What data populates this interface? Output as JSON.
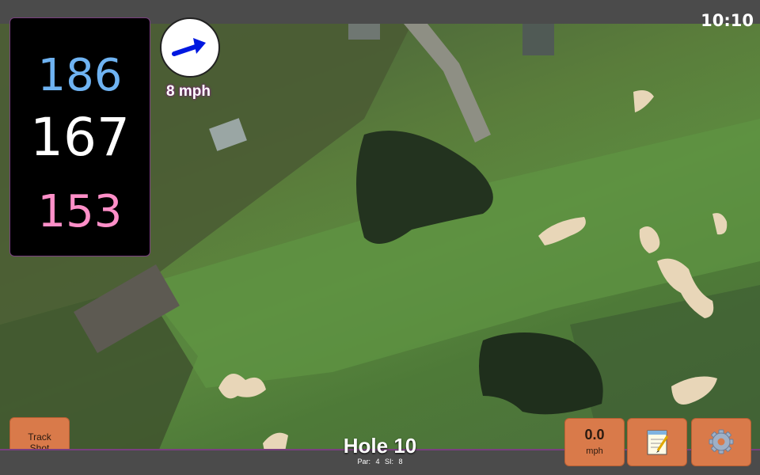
{
  "status_bar": {
    "time": "10:10"
  },
  "distances": {
    "back": "186",
    "middle": "167",
    "front": "153"
  },
  "wind": {
    "speed_label": "8 mph",
    "direction_icon": "wind-arrow-icon"
  },
  "buttons": {
    "track_shot_line1": "Track",
    "track_shot_line2": "Shot",
    "speed_value": "0.0",
    "speed_unit": "mph",
    "notes_icon": "notepad-icon",
    "settings_icon": "gear-icon"
  },
  "hole": {
    "title": "Hole 10",
    "par_label": "Par: 4",
    "si_label": "SI: 8"
  },
  "colors": {
    "back_distance": "#6fb3f2",
    "middle_distance": "#ffffff",
    "front_distance": "#ff8fc8",
    "button_bg": "#d97a4a",
    "accent_border": "#7a3f80"
  }
}
